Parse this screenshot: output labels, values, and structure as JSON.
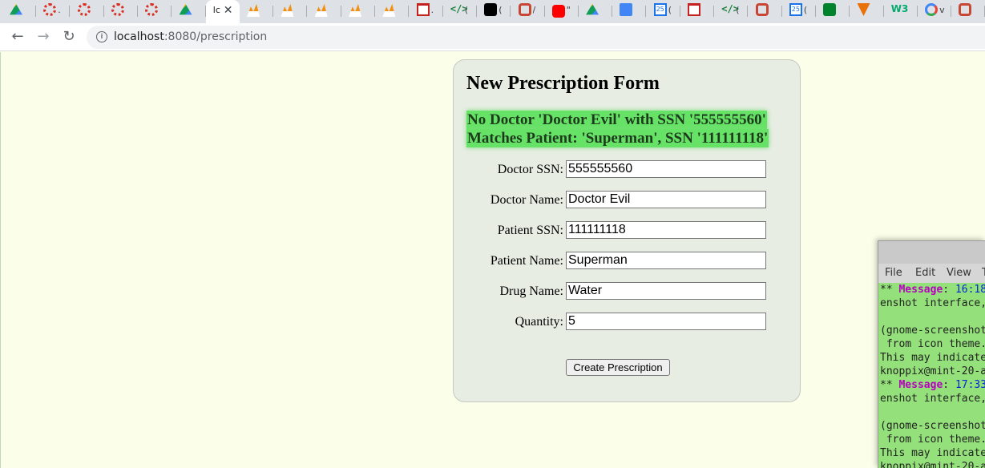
{
  "browser": {
    "tabs": [
      {
        "icon": "google-drive-icon",
        "title": ""
      },
      {
        "icon": "red-ring-icon",
        "title": "."
      },
      {
        "icon": "red-ring-icon",
        "title": ""
      },
      {
        "icon": "red-ring-icon",
        "title": ""
      },
      {
        "icon": "red-ring-icon",
        "title": ""
      },
      {
        "icon": "google-drive-icon",
        "title": ""
      },
      {
        "icon": "current-page-icon",
        "title": "lc",
        "active": true
      },
      {
        "icon": "phpmyadmin-icon",
        "title": ""
      },
      {
        "icon": "phpmyadmin-icon",
        "title": ""
      },
      {
        "icon": "phpmyadmin-icon",
        "title": ""
      },
      {
        "icon": "phpmyadmin-icon",
        "title": ""
      },
      {
        "icon": "phpmyadmin-icon",
        "title": ""
      },
      {
        "icon": "gmail-icon",
        "title": "."
      },
      {
        "icon": "code-icon",
        "title": "("
      },
      {
        "icon": "black-square-icon",
        "title": "("
      },
      {
        "icon": "oracle-icon",
        "title": "/"
      },
      {
        "icon": "youtube-icon",
        "title": "\""
      },
      {
        "icon": "google-drive-icon",
        "title": ""
      },
      {
        "icon": "google-docs-icon",
        "title": ""
      },
      {
        "icon": "google-calendar-icon",
        "title": "("
      },
      {
        "icon": "gmail-icon",
        "title": ""
      },
      {
        "icon": "code-icon",
        "title": "("
      },
      {
        "icon": "oracle-icon",
        "title": ""
      },
      {
        "icon": "google-calendar-icon",
        "title": "("
      },
      {
        "icon": "google-meet-icon",
        "title": ""
      },
      {
        "icon": "v-icon",
        "title": ""
      },
      {
        "icon": "w3schools-icon",
        "title": ""
      },
      {
        "icon": "google-icon",
        "title": "v"
      },
      {
        "icon": "oracle-icon",
        "title": ""
      }
    ],
    "active_tab_close": "✕",
    "nav": {
      "back": "←",
      "forward": "→",
      "reload": "↻"
    },
    "url_host": "localhost",
    "url_path": ":8080/prescription"
  },
  "form": {
    "title": "New Prescription Form",
    "error_line1": "No Doctor 'Doctor Evil' with SSN '555555560'",
    "error_line2": "Matches Patient: 'Superman', SSN '111111118'",
    "fields": [
      {
        "label": "Doctor SSN:",
        "value": "555555560"
      },
      {
        "label": "Doctor Name:",
        "value": "Doctor Evil"
      },
      {
        "label": "Patient SSN:",
        "value": "111111118"
      },
      {
        "label": "Patient Name:",
        "value": "Superman"
      },
      {
        "label": "Drug Name:",
        "value": "Water"
      },
      {
        "label": "Quantity:",
        "value": "5"
      }
    ],
    "submit_label": "Create Prescription"
  },
  "terminal": {
    "menu": [
      "File",
      "Edit",
      "View",
      "T"
    ],
    "lines": [
      {
        "prefix": "** ",
        "msg": "Message",
        "sep": ": ",
        "ts": "16:18"
      },
      {
        "text": "enshot interface,"
      },
      {
        "text": ""
      },
      {
        "text": "(gnome-screenshot"
      },
      {
        "text": " from icon theme."
      },
      {
        "text": "This may indicate"
      },
      {
        "text": "knoppix@mint-20-a"
      },
      {
        "prefix": "** ",
        "msg": "Message",
        "sep": ": ",
        "ts": "17:33"
      },
      {
        "text": "enshot interface,"
      },
      {
        "text": ""
      },
      {
        "text": "(gnome-screenshot"
      },
      {
        "text": " from icon theme."
      },
      {
        "text": "This may indicate"
      },
      {
        "text": "knoppix@mint-20-a"
      }
    ]
  },
  "colors": {
    "page_bg": "#fbffe9",
    "card_bg": "#e8ede4",
    "error_highlight": "#66e266",
    "terminal_bg": "#94e07a"
  }
}
